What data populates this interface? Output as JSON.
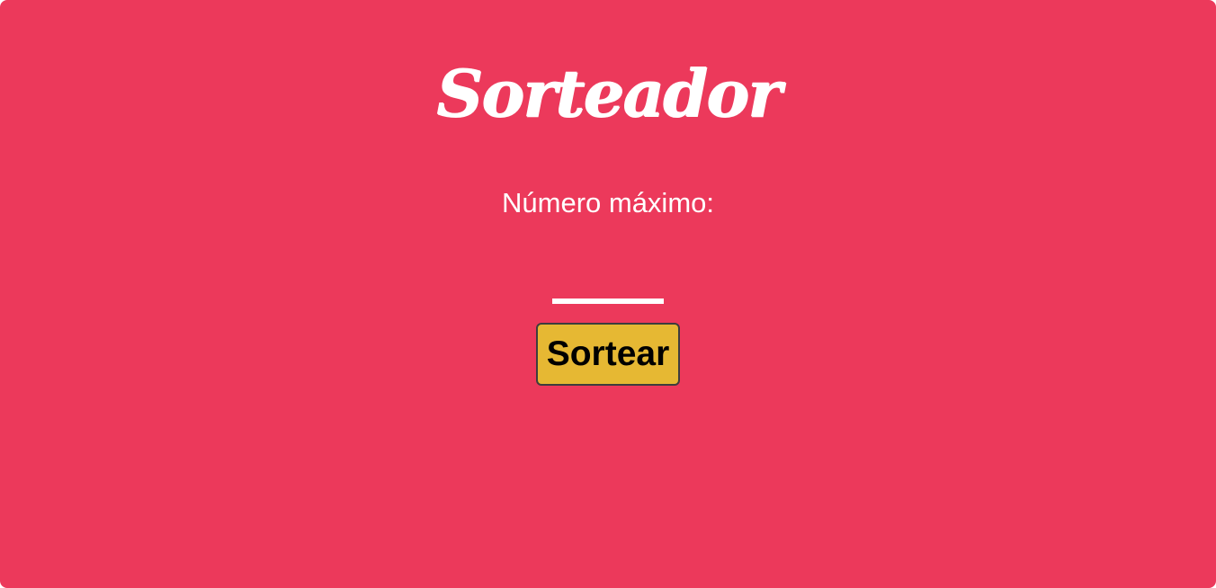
{
  "app": {
    "title": "Sorteador",
    "background_color": "#ec395b"
  },
  "form": {
    "label": "Número máximo:",
    "input_value": "",
    "button_label": "Sortear",
    "button_color": "#e6b833"
  }
}
